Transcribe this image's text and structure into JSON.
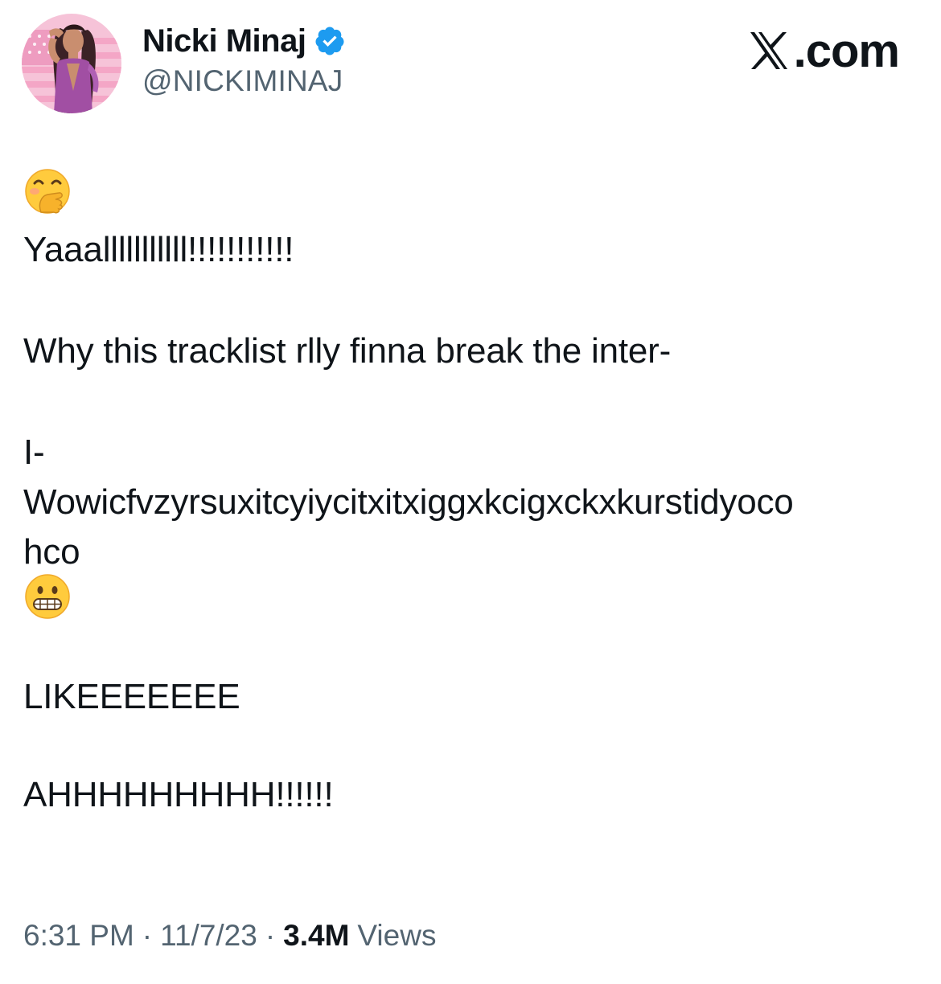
{
  "author": {
    "display_name": "Nicki Minaj",
    "handle": "@NICKIMINAJ",
    "verified": true
  },
  "brand": {
    "label": ".com",
    "logo_icon": "x-logo-icon"
  },
  "tweet": {
    "lines": [
      "Yaaalllllllllll!!!!!!!!!!!",
      "Why this tracklist  rlly finna break the inter-",
      "I-",
      "Wowicfvzyrsuxitcyiycitxitxiggxkcigxckxkurstidyoco",
      "hco",
      "LIKEEEEEEE",
      "AHHHHHHHHH!!!!!!"
    ],
    "emoji_1": "face-with-hand-over-mouth",
    "emoji_2": "grimacing-face"
  },
  "meta": {
    "time": "6:31 PM",
    "date": "11/7/23",
    "views_count": "3.4M",
    "views_label": "Views",
    "separator": "·"
  },
  "colors": {
    "text_primary": "#0f1419",
    "text_secondary": "#536471",
    "verified_blue": "#1d9bf0",
    "avatar_pink": "#f3a9c9"
  }
}
